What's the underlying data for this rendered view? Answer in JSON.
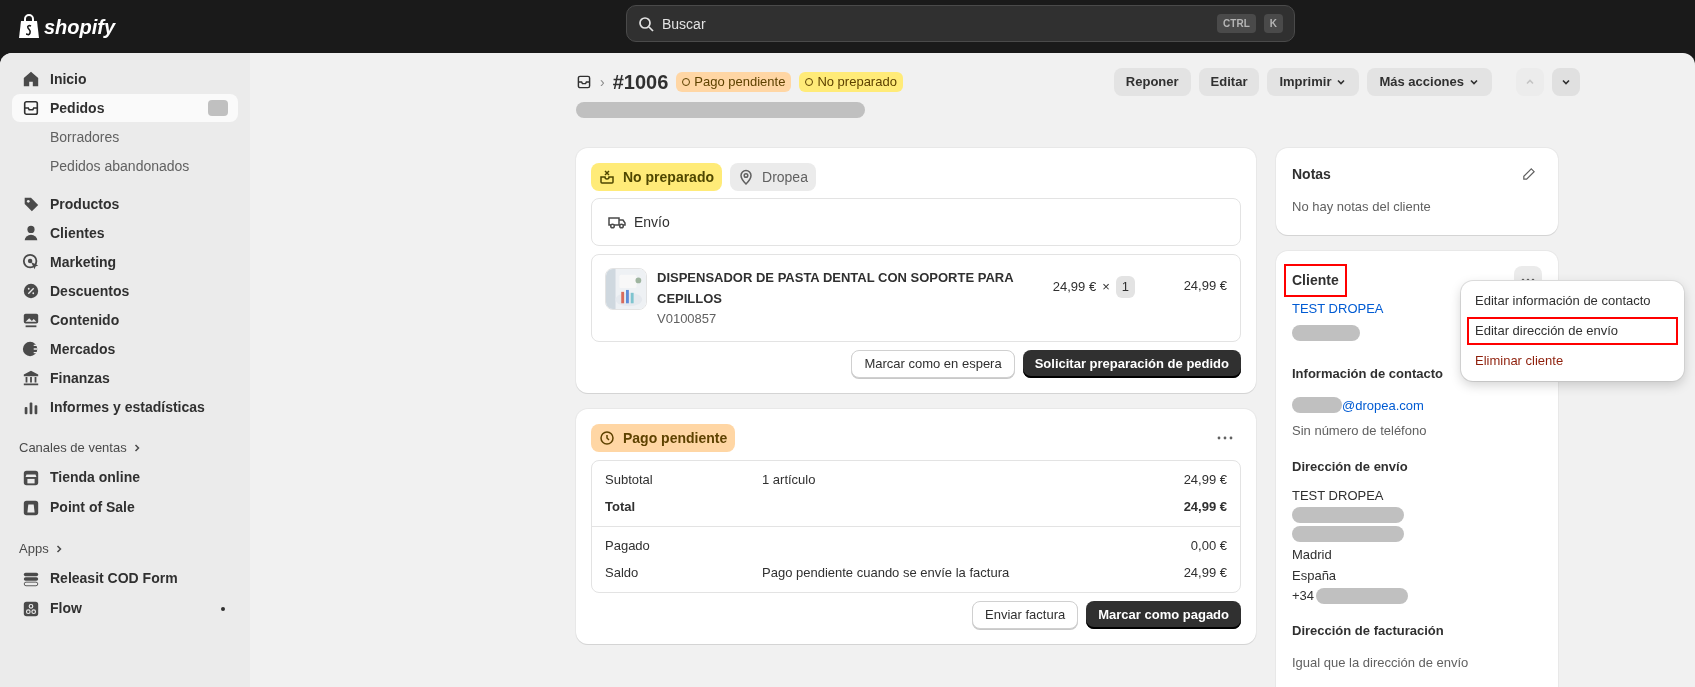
{
  "topbar": {
    "logo": "shopify",
    "search": {
      "placeholder": "Buscar"
    },
    "shortcut_keys": [
      "CTRL",
      "K"
    ]
  },
  "sidebar": {
    "nav": [
      {
        "label": "Inicio",
        "selected": false
      },
      {
        "label": "Pedidos",
        "selected": true,
        "redacted_count": true,
        "children": [
          {
            "label": "Borradores"
          },
          {
            "label": "Pedidos abandonados"
          }
        ]
      },
      {
        "label": "Productos",
        "selected": false
      },
      {
        "label": "Clientes",
        "selected": false
      },
      {
        "label": "Marketing",
        "selected": false
      },
      {
        "label": "Descuentos",
        "selected": false
      },
      {
        "label": "Contenido",
        "selected": false
      },
      {
        "label": "Mercados",
        "selected": false
      },
      {
        "label": "Finanzas",
        "selected": false
      },
      {
        "label": "Informes y estadísticas",
        "selected": false
      }
    ],
    "sections": [
      {
        "title": "Canales de ventas",
        "items": [
          {
            "label": "Tienda online",
            "notification": false
          },
          {
            "label": "Point of Sale",
            "notification": false
          }
        ]
      },
      {
        "title": "Apps",
        "items": [
          {
            "label": "Releasit COD Form",
            "notification": false
          },
          {
            "label": "Flow",
            "notification": true
          }
        ]
      }
    ]
  },
  "header": {
    "separator": "›",
    "order": "#1006",
    "badges": [
      {
        "label": "Pago pendiente",
        "color": "#ffd6a4"
      },
      {
        "label": "No preparado",
        "color": "#ffeb78"
      }
    ],
    "actions": [
      {
        "label": "Reponer",
        "dropdown": false
      },
      {
        "label": "Editar",
        "dropdown": false
      },
      {
        "label": "Imprimir",
        "dropdown": true
      },
      {
        "label": "Más acciones",
        "dropdown": true
      }
    ],
    "pager": [
      {
        "disabled": true
      },
      {
        "disabled": false
      }
    ]
  },
  "fulfillment": {
    "status": "No preparado",
    "location": "Dropea",
    "delivery": "Envío",
    "item": {
      "title": "DISPENSADOR DE PASTA DENTAL CON SOPORTE PARA CEPILLOS",
      "sku": "V0100857",
      "price": "24,99 €",
      "times": "×",
      "quantity": "1",
      "total": "24,99 €"
    },
    "buttons": [
      {
        "label": "Marcar como en espera",
        "primary": false
      },
      {
        "label": "Solicitar preparación de pedido",
        "primary": true
      }
    ]
  },
  "payment": {
    "status": "Pago pendiente",
    "groups": [
      [
        {
          "label": "Subtotal",
          "detail": "1 artículo",
          "amount": "24,99 €",
          "bold": false
        },
        {
          "label": "Total",
          "amount": "24,99 €",
          "bold": true
        }
      ],
      [
        {
          "label": "Pagado",
          "amount": "0,00 €",
          "bold": false
        },
        {
          "label": "Saldo",
          "detail": "Pago pendiente cuando se envíe la factura",
          "amount": "24,99 €",
          "bold": false
        }
      ]
    ],
    "buttons": [
      {
        "label": "Enviar factura",
        "primary": false
      },
      {
        "label": "Marcar como pagado",
        "primary": true
      }
    ]
  },
  "notes": {
    "title": "Notas",
    "text": "No hay notas del cliente"
  },
  "customer": {
    "title": "Cliente",
    "highlighted": true,
    "name": "TEST DROPEA",
    "contact": {
      "title": "Información de contacto",
      "email_domain": "@dropea.com",
      "phone": "Sin número de teléfono"
    },
    "shipping": {
      "title": "Dirección de envío",
      "lines": [
        {
          "kind": "text",
          "text": "TEST DROPEA"
        },
        {
          "kind": "redacted"
        },
        {
          "kind": "redacted"
        },
        {
          "kind": "text",
          "text": "Madrid"
        },
        {
          "kind": "text",
          "text": "España"
        },
        {
          "kind": "prefix",
          "text": "+34"
        }
      ]
    },
    "billing": {
      "title": "Dirección de facturación",
      "text": "Igual que la dirección de envío"
    },
    "menu": [
      {
        "label": "Editar información de contacto",
        "highlighted": false,
        "destructive": false
      },
      {
        "label": "Editar dirección de envío",
        "highlighted": true,
        "destructive": false
      },
      {
        "label": "Eliminar cliente",
        "highlighted": false,
        "destructive": true
      }
    ]
  }
}
